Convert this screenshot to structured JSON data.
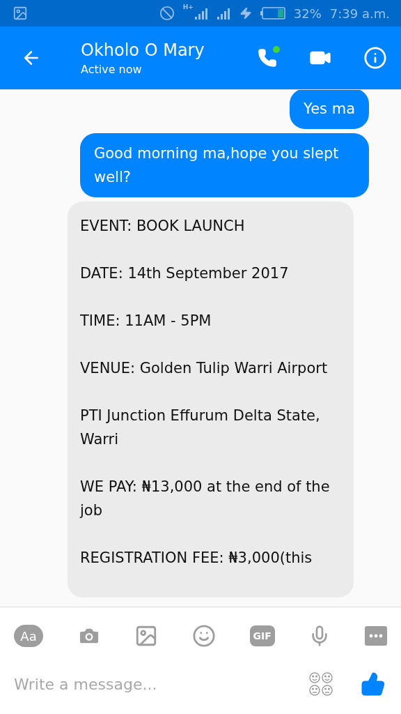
{
  "status_bar": {
    "network_label": "H+",
    "battery": "32%",
    "time": "7:39 a.m."
  },
  "header": {
    "name": "Okholo O Mary",
    "status": "Active now",
    "online": true
  },
  "messages": [
    {
      "kind": "sent",
      "paragraphs": [
        "Yes ma"
      ]
    },
    {
      "kind": "sent",
      "paragraphs": [
        "Good morning ma,hope you slept well?"
      ]
    },
    {
      "kind": "received",
      "paragraphs": [
        "EVENT: BOOK LAUNCH",
        "DATE: 14th September 2017",
        "TIME: 11AM - 5PM",
        "VENUE: Golden Tulip Warri Airport",
        "PTI Junction Effurum Delta State, Warri",
        "WE PAY: ₦13,000 at the end of the job",
        "REGISTRATION FEE: ₦3,000(this"
      ]
    }
  ],
  "composer": {
    "text_button": "Aa",
    "gif_button": "GIF",
    "placeholder": "Write a message..."
  }
}
